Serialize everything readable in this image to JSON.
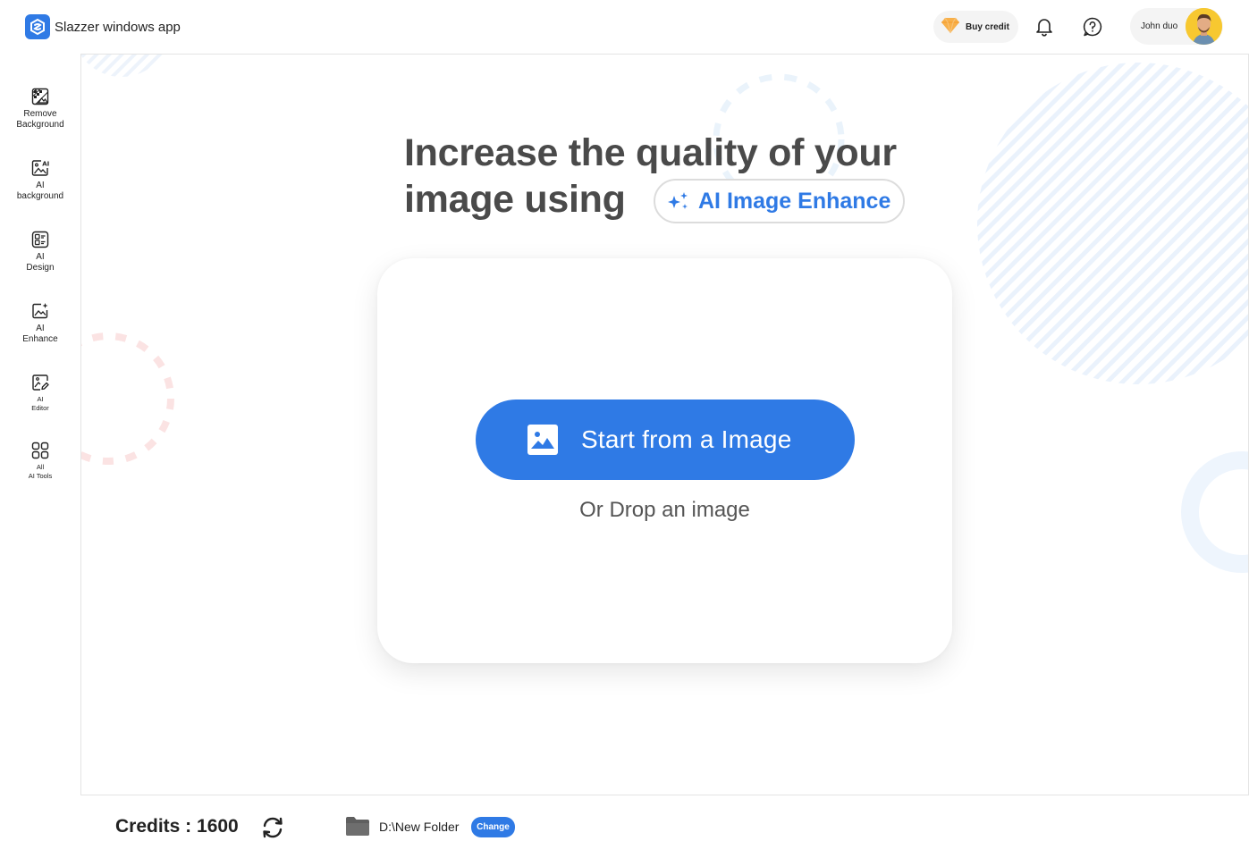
{
  "header": {
    "app_title": "Slazzer windows app",
    "buy_credit_label": "Buy credit",
    "user_name": "John duo"
  },
  "sidebar": {
    "items": [
      {
        "label": "Remove\nBackground",
        "icon": "remove-background-icon"
      },
      {
        "label": "AI\nbackground",
        "icon": "ai-background-icon"
      },
      {
        "label": "AI\nDesign",
        "icon": "ai-design-icon"
      },
      {
        "label": "AI\nEnhance",
        "icon": "ai-enhance-icon"
      },
      {
        "label": "AI\nEditor",
        "icon": "ai-editor-icon"
      },
      {
        "label": "All\nAI Tools",
        "icon": "all-ai-tools-icon"
      }
    ]
  },
  "main": {
    "headline": "Increase the quality of your image using",
    "feature_label": "AI Image Enhance",
    "start_button_label": "Start from a Image",
    "drop_text": "Or Drop an image"
  },
  "footer": {
    "credits_label": "Credits : 1600",
    "folder_path": "D:\\New Folder",
    "change_label": "Change"
  },
  "colors": {
    "accent": "#2f7ae5",
    "headline": "#4a4a4a",
    "deco_pink": "#fbe3e3",
    "deco_blue": "#eaf2fc"
  }
}
